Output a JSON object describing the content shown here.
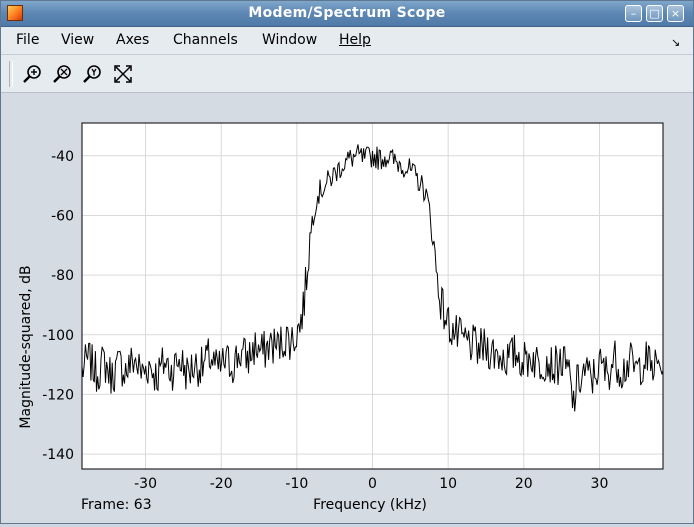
{
  "window": {
    "title": "Modem/Spectrum Scope",
    "controls": {
      "minimize": "–",
      "maximize": "□",
      "close": "×"
    }
  },
  "menu": {
    "items": [
      "File",
      "View",
      "Axes",
      "Channels",
      "Window",
      "Help"
    ],
    "dock_arrow": "↘"
  },
  "toolbar": {
    "tools": [
      "zoom-in-icon",
      "zoom-x-icon",
      "zoom-y-icon",
      "autoscale-icon"
    ]
  },
  "status": {
    "frame": "Frame: 63"
  },
  "chart_data": {
    "type": "line",
    "title": "",
    "xlabel": "Frequency (kHz)",
    "ylabel": "Magnitude-squared, dB",
    "xlim": [
      -38.4,
      38.4
    ],
    "ylim": [
      -145,
      -29
    ],
    "xticks": [
      -30,
      -20,
      -10,
      0,
      10,
      20,
      30
    ],
    "xtick_labels": [
      "-30",
      "-20",
      "-10",
      "0",
      "10",
      "20",
      "30"
    ],
    "yticks": [
      -40,
      -60,
      -80,
      -100,
      -120,
      -140
    ],
    "ytick_labels": [
      "-40",
      "-60",
      "-80",
      "-100",
      "-120",
      "-140"
    ],
    "grid": true,
    "line_color": "#000000",
    "series": [
      {
        "x": [
          -38.4,
          -37.5,
          -36.5,
          -35.5,
          -34.5,
          -33.5,
          -32.5,
          -31.5,
          -30.5,
          -29.5,
          -28.5,
          -27.5,
          -26.5,
          -25.5,
          -24.5,
          -23.5,
          -22.5,
          -21.5,
          -20.5,
          -19.5,
          -18.5,
          -17.5,
          -16.5,
          -15.5,
          -14.5,
          -13.5,
          -12.5,
          -11.5,
          -10.5,
          -9.5,
          -9.0,
          -8.5,
          -8.0,
          -7.5,
          -7.0,
          -6.0,
          -5.0,
          -4.0,
          -3.0,
          -2.0,
          -1.0,
          0.0,
          1.0,
          2.0,
          3.0,
          4.0,
          5.0,
          6.0,
          7.0,
          7.5,
          8.0,
          8.5,
          9.0,
          9.5,
          10.0,
          11.0,
          12.0,
          13.0,
          14.0,
          15.0,
          16.0,
          17.0,
          18.0,
          19.0,
          20.0,
          21.0,
          22.0,
          23.0,
          24.0,
          25.0,
          26.0,
          26.5,
          27.0,
          28.0,
          29.0,
          30.0,
          31.0,
          32.0,
          33.0,
          34.0,
          35.0,
          36.0,
          37.0,
          38.4
        ],
        "y": [
          -112,
          -108,
          -113,
          -109,
          -114,
          -110,
          -112,
          -108,
          -113,
          -110,
          -114,
          -109,
          -112,
          -108,
          -113,
          -110,
          -111,
          -107,
          -112,
          -109,
          -110,
          -106,
          -108,
          -104,
          -106,
          -103,
          -104,
          -101,
          -102,
          -96,
          -88,
          -74,
          -62,
          -55,
          -52,
          -49,
          -46,
          -43,
          -41,
          -40,
          -41,
          -40,
          -41,
          -40,
          -42,
          -43,
          -45,
          -48,
          -52,
          -58,
          -68,
          -80,
          -88,
          -93,
          -96,
          -100,
          -102,
          -103,
          -105,
          -104,
          -106,
          -107,
          -108,
          -106,
          -109,
          -107,
          -110,
          -108,
          -111,
          -109,
          -113,
          -124,
          -117,
          -112,
          -115,
          -110,
          -113,
          -108,
          -112,
          -109,
          -112,
          -108,
          -111,
          -110
        ]
      }
    ]
  }
}
